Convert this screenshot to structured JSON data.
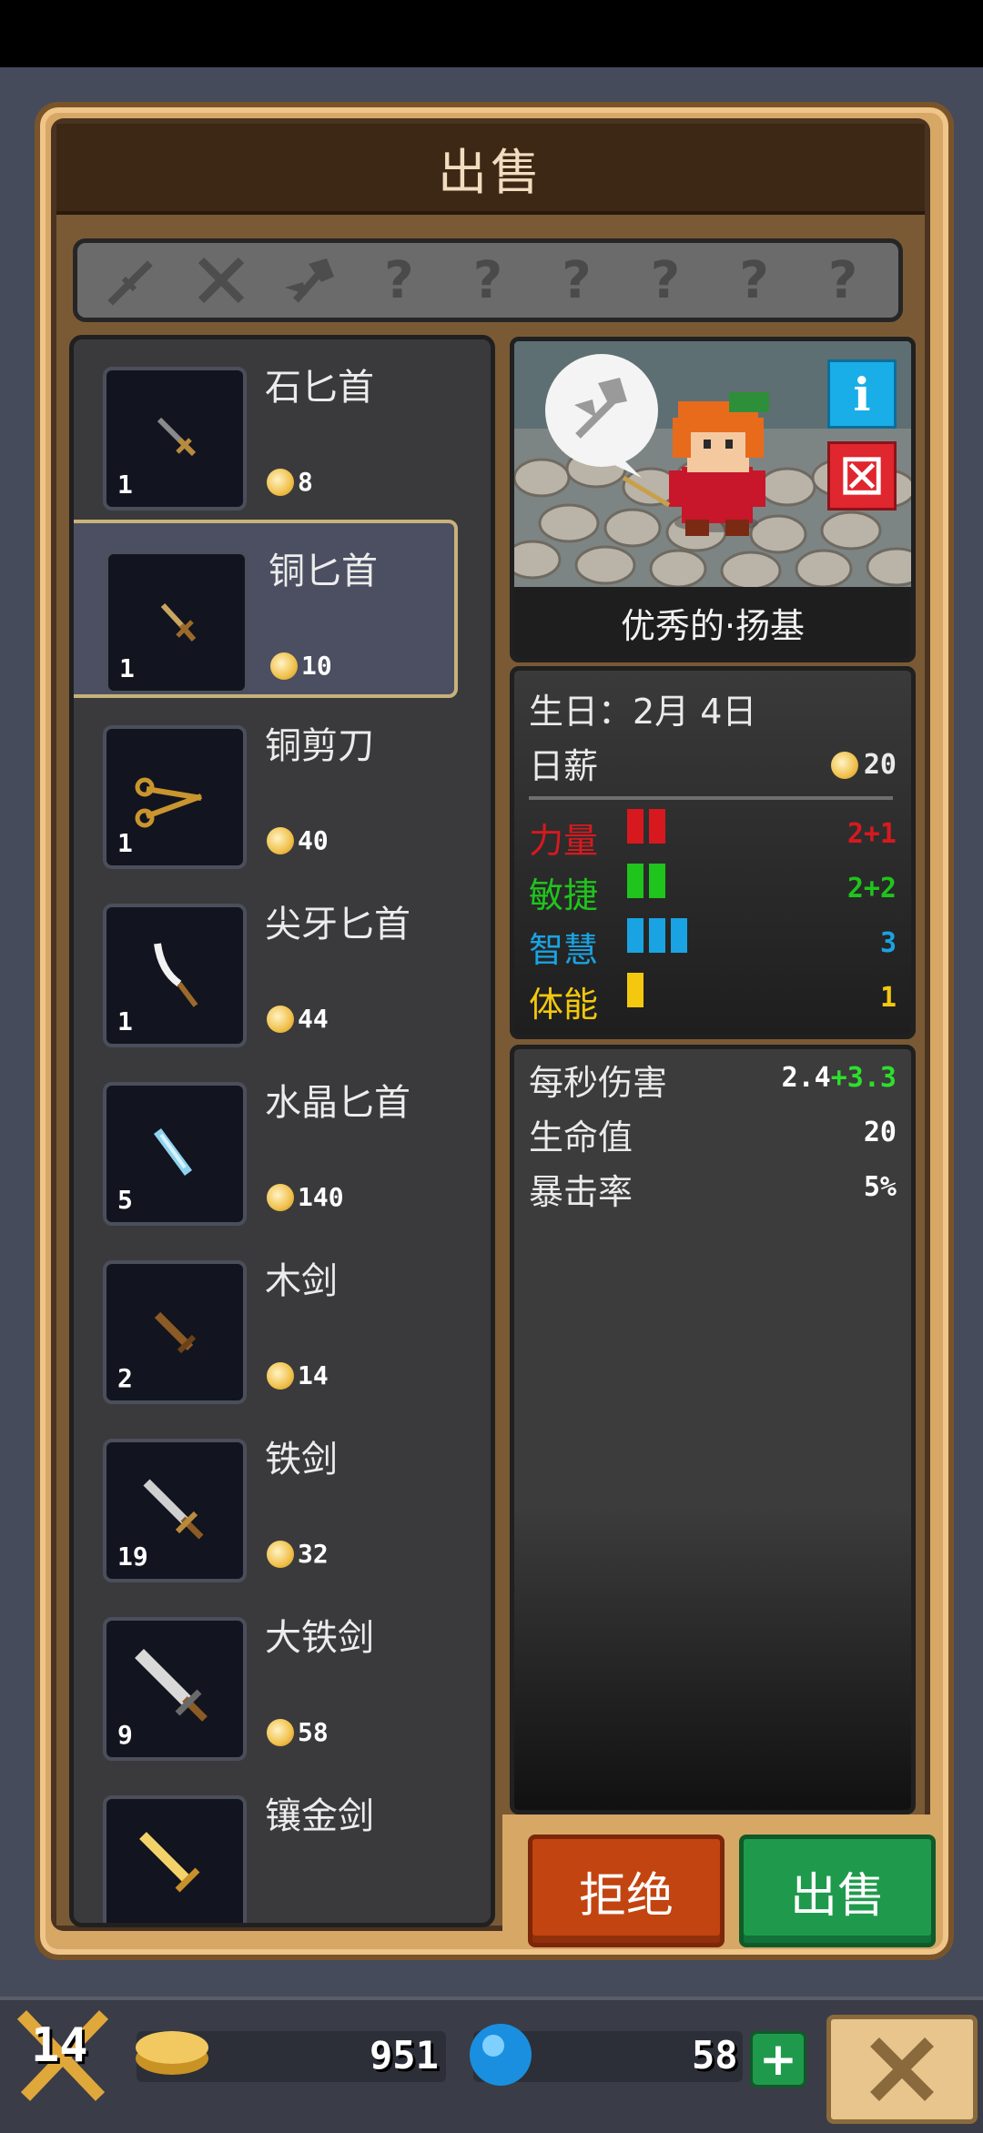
{
  "title": "出售",
  "slots": [
    "dagger",
    "swords",
    "axe",
    "?",
    "?",
    "?",
    "?",
    "?",
    "?"
  ],
  "items": [
    {
      "name": "石匕首",
      "qty": "1",
      "price": "8"
    },
    {
      "name": "铜匕首",
      "qty": "1",
      "price": "10",
      "selected": true
    },
    {
      "name": "铜剪刀",
      "qty": "1",
      "price": "40"
    },
    {
      "name": "尖牙匕首",
      "qty": "1",
      "price": "44"
    },
    {
      "name": "水晶匕首",
      "qty": "5",
      "price": "140"
    },
    {
      "name": "木剑",
      "qty": "2",
      "price": "14"
    },
    {
      "name": "铁剑",
      "qty": "19",
      "price": "32"
    },
    {
      "name": "大铁剑",
      "qty": "9",
      "price": "58"
    },
    {
      "name": "镶金剑",
      "qty": "",
      "price": ""
    }
  ],
  "hero": {
    "name": "优秀的·扬基",
    "birthday_label": "生日：2月 4日",
    "salary_label": "日薪",
    "salary": "20"
  },
  "attributes": [
    {
      "label": "力量",
      "value": "2+1",
      "bars": 2,
      "color": "#d7191f"
    },
    {
      "label": "敏捷",
      "value": "2+2",
      "bars": 2,
      "color": "#1fc41c"
    },
    {
      "label": "智慧",
      "value": "3",
      "bars": 3,
      "color": "#1aa3e2"
    },
    {
      "label": "体能",
      "value": "1",
      "bars": 1,
      "color": "#f3c80f"
    }
  ],
  "combat": {
    "dps_label": "每秒伤害",
    "dps_base": "2.4",
    "dps_bonus": "+3.3",
    "hp_label": "生命值",
    "hp": "20",
    "crit_label": "暴击率",
    "crit": "5%"
  },
  "buttons": {
    "reject": "拒绝",
    "sell": "出售"
  },
  "bottom": {
    "level": "14",
    "gold": "951",
    "gems": "58",
    "plus": "+"
  }
}
